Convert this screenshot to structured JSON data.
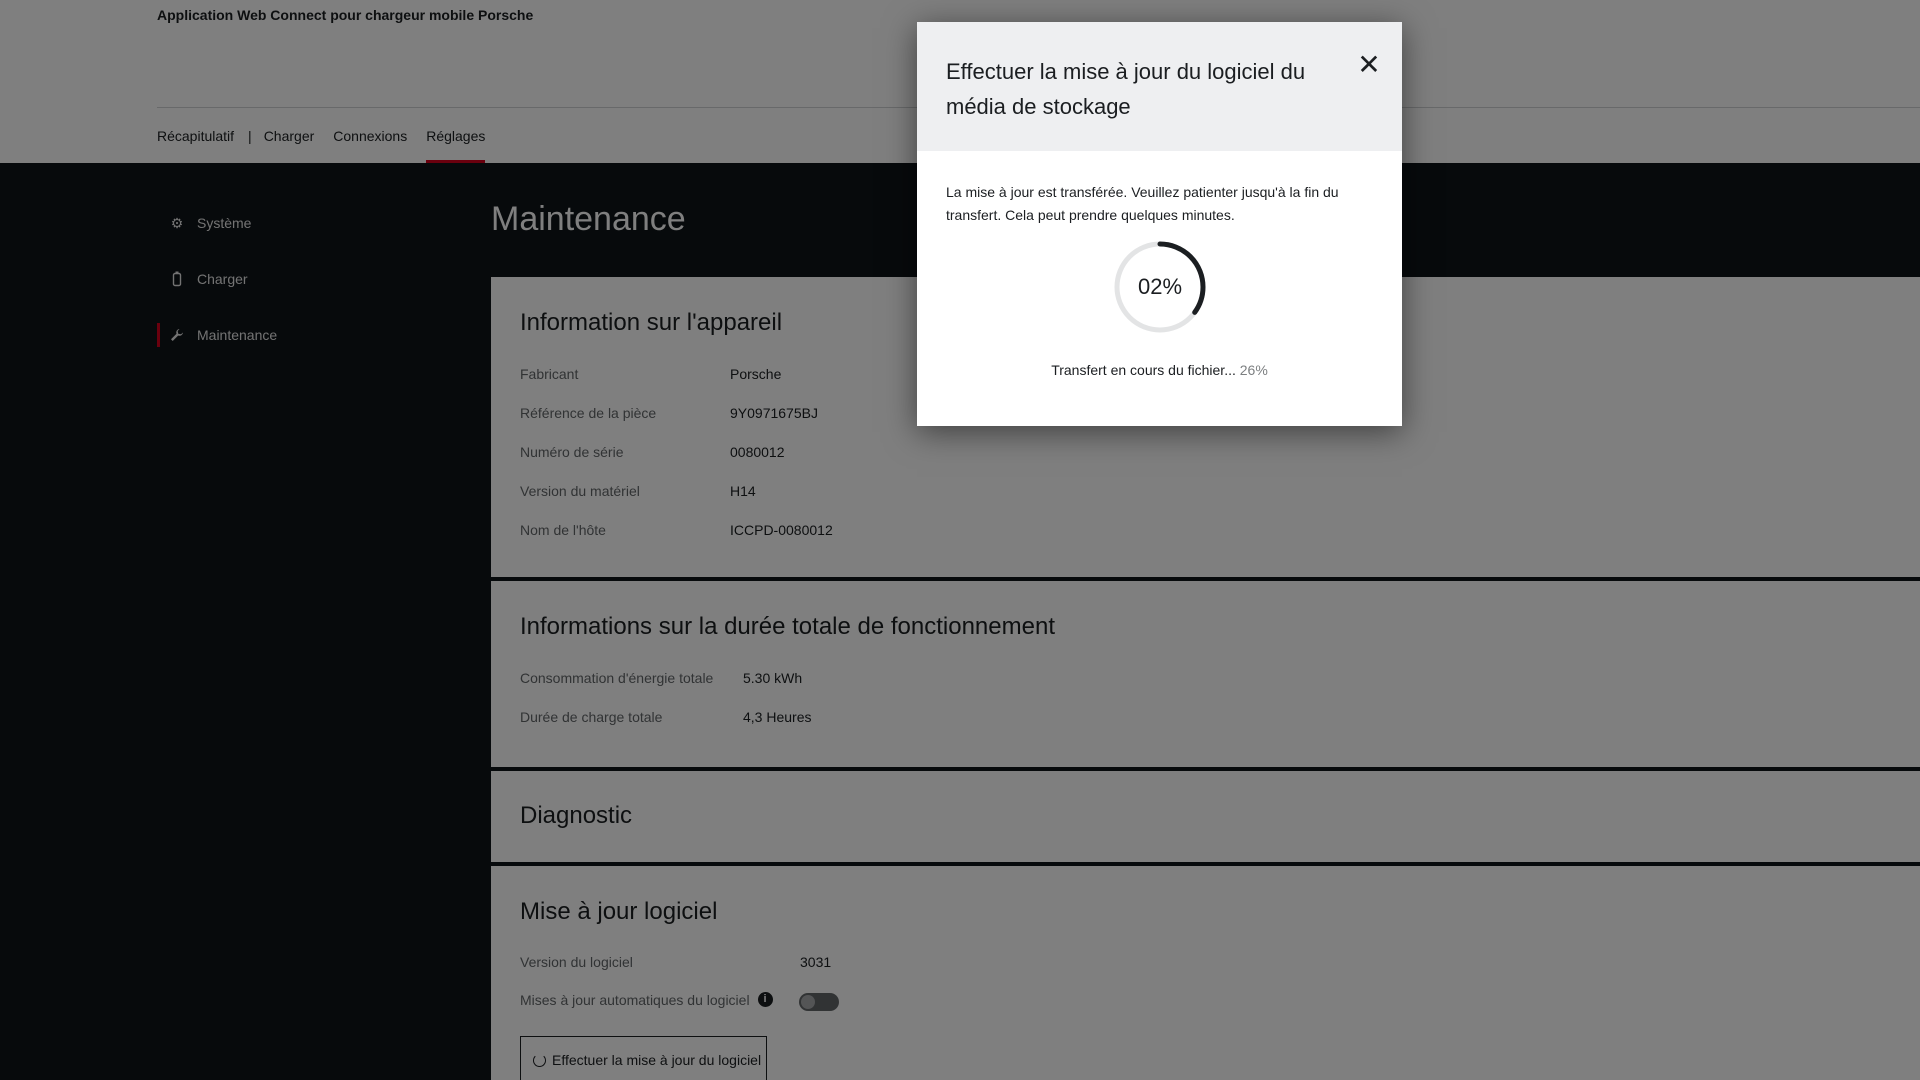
{
  "app": {
    "title": "Application Web Connect pour chargeur mobile Porsche"
  },
  "nav": {
    "items": [
      {
        "label": "Récapitulatif"
      },
      {
        "label": "Charger"
      },
      {
        "label": "Connexions"
      },
      {
        "label": "Réglages",
        "active": true
      }
    ],
    "separator": "|"
  },
  "sidebar": {
    "items": [
      {
        "label": "Système",
        "icon": "gear-icon"
      },
      {
        "label": "Charger",
        "icon": "charger-icon"
      },
      {
        "label": "Maintenance",
        "icon": "wrench-icon",
        "active": true
      }
    ]
  },
  "page": {
    "title": "Maintenance"
  },
  "device_info": {
    "title": "Information sur l'appareil",
    "rows": [
      {
        "label": "Fabricant",
        "value": "Porsche"
      },
      {
        "label": "Référence de la pièce",
        "value": "9Y0971675BJ"
      },
      {
        "label": "Numéro de série",
        "value": "0080012"
      },
      {
        "label": "Version du matériel",
        "value": "H14"
      },
      {
        "label": "Nom de l'hôte",
        "value": "ICCPD-0080012"
      }
    ]
  },
  "runtime_info": {
    "title": "Informations sur la durée totale de fonctionnement",
    "rows": [
      {
        "label": "Consommation d'énergie totale",
        "value": "5.30 kWh"
      },
      {
        "label": "Durée de charge totale",
        "value": "4,3 Heures"
      }
    ]
  },
  "diagnostic": {
    "title": "Diagnostic"
  },
  "software_update": {
    "title": "Mise à jour logiciel",
    "version_label": "Version du logiciel",
    "version_value": "3031",
    "auto_label": "Mises à jour automatiques du logiciel",
    "info_glyph": "i",
    "auto_enabled": false,
    "button_label": "Effectuer la mise à jour du logiciel"
  },
  "modal": {
    "title": "Effectuer la mise à jour du logiciel du média de stockage",
    "close_glyph": "✕",
    "message": "La mise à jour est transférée. Veuillez patienter jusqu'à la fin du transfert. Cela peut prendre quelques minutes.",
    "progress_label": "02%",
    "progress_fraction": 0.02,
    "transfer_text": "Transfert en cours du fichier...",
    "transfer_pct": "26%"
  },
  "colors": {
    "accent": "#d5001c",
    "dark_bg": "#0e1418",
    "modal_head": "#eeeff1"
  }
}
